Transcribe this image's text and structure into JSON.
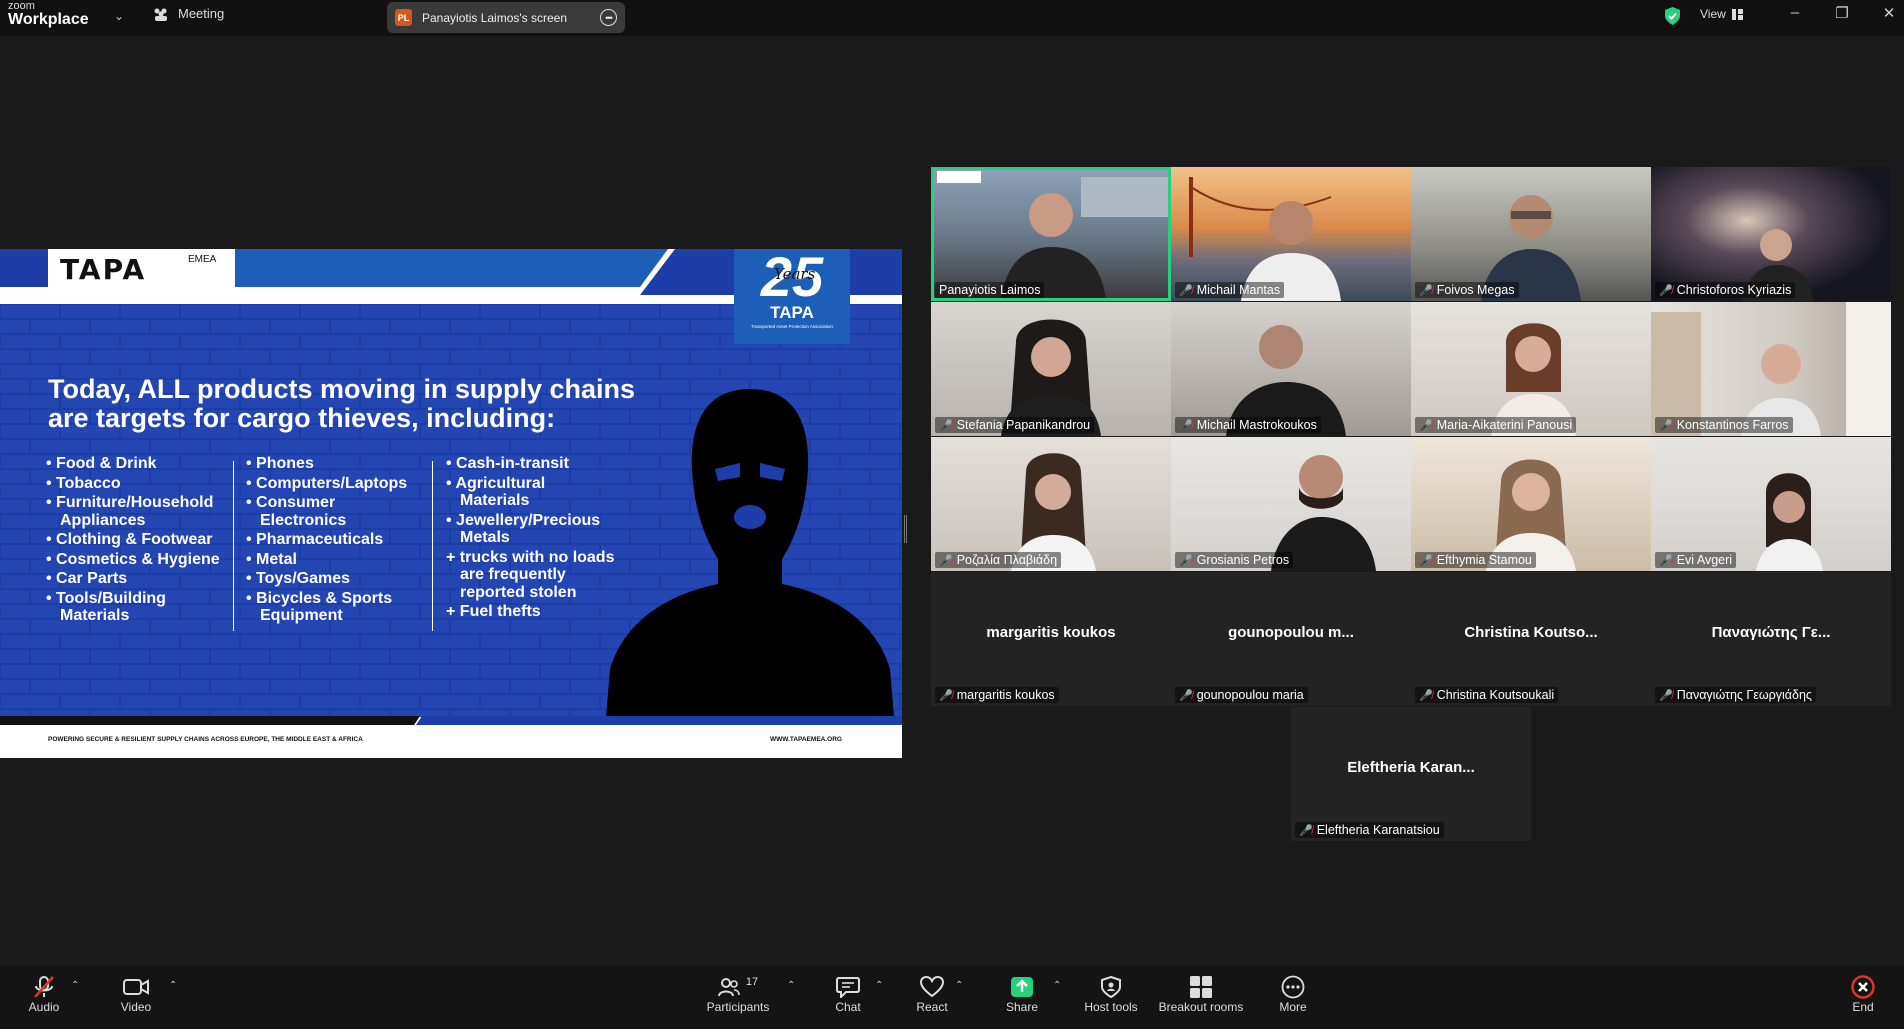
{
  "app": {
    "logo_top": "zoom",
    "logo_bottom": "Workplace",
    "meeting_label": "Meeting",
    "screen_tab_badge": "PL",
    "screen_tab_label": "Panayiotis Laimos's screen",
    "view_label": "View",
    "accent_green": "#26d07c"
  },
  "slide": {
    "logo_text": "TAPA",
    "logo_sup": "EMEA",
    "badge_number": "25",
    "badge_script": "Years",
    "badge_tapa": "TAPA",
    "badge_caption": "Transported Asset Protection Association",
    "headline_line1": "Today, ALL products moving in supply chains",
    "headline_line2": "are targets for cargo thieves, including:",
    "col1": [
      "Food & Drink",
      "Tobacco",
      "Furniture/Household",
      "Appliances",
      "Clothing & Footwear",
      "Cosmetics & Hygiene",
      "Car Parts",
      "Tools/Building",
      "Materials"
    ],
    "col2": [
      "Phones",
      "Computers/Laptops",
      "Consumer",
      "Electronics",
      "Pharmaceuticals",
      "Metal",
      "Toys/Games",
      "Bicycles & Sports",
      "Equipment"
    ],
    "col3": [
      "Cash-in-transit",
      "Agricultural",
      "Materials",
      "Jewellery/Precious",
      "Metals",
      "+ trucks with no loads",
      "are frequently",
      "reported stolen",
      "+ Fuel thefts"
    ],
    "footer_left": "POWERING SECURE & RESILIENT SUPPLY CHAINS ACROSS EUROPE, THE MIDDLE EAST & AFRICA",
    "footer_right": "WWW.TAPAEMEA.ORG"
  },
  "participants": [
    {
      "name": "Panayiotis Laimos",
      "muted": false
    },
    {
      "name": "Michail Mantas",
      "muted": true
    },
    {
      "name": "Foivos Megas",
      "muted": true
    },
    {
      "name": "Christoforos Kyriazis",
      "muted": true
    },
    {
      "name": "Stefania Papanikandrou",
      "muted": true
    },
    {
      "name": "Michail Mastrokoukos",
      "muted": true
    },
    {
      "name": "Maria-Aikaterini Panousi",
      "muted": true
    },
    {
      "name": "Konstantinos Farros",
      "muted": true
    },
    {
      "name": "Ροζαλία Πλαβιάδη",
      "muted": true
    },
    {
      "name": "Grosianis Petros",
      "muted": true
    },
    {
      "name": "Efthymia Stamou",
      "muted": true
    },
    {
      "name": "Evi Avgeri",
      "muted": true
    },
    {
      "name": "margaritis koukos",
      "display": "margaritis koukos",
      "muted": true
    },
    {
      "name": "gounopoulou maria",
      "display": "gounopoulou  m...",
      "muted": true
    },
    {
      "name": "Christina Koutsoukali",
      "display": "Christina  Koutso...",
      "muted": true
    },
    {
      "name": "Παναγιώτης Γεωργιάδης",
      "display": "Παναγιώτης Γε...",
      "muted": true
    },
    {
      "name": "Eleftheria Karanatsiou",
      "display": "Eleftheria  Karan...",
      "muted": true
    }
  ],
  "toolbar": {
    "audio": "Audio",
    "video": "Video",
    "participants": "Participants",
    "participants_count": "17",
    "chat": "Chat",
    "react": "React",
    "share": "Share",
    "host_tools": "Host tools",
    "breakout_rooms": "Breakout rooms",
    "more": "More",
    "end": "End"
  }
}
